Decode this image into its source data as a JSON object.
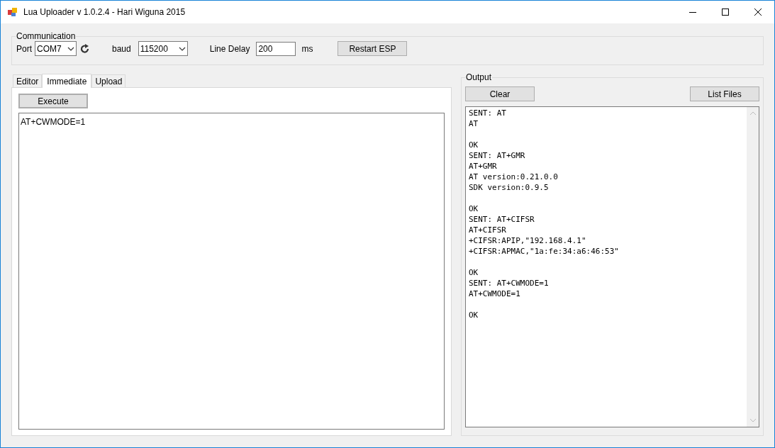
{
  "window": {
    "title": "Lua Uploader v 1.0.2.4 - Hari Wiguna 2015"
  },
  "communication": {
    "title": "Communication",
    "port_label": "Port",
    "port": "COM7",
    "baud_label": "baud",
    "baud": "115200",
    "line_delay_label": "Line Delay",
    "line_delay": "200",
    "line_delay_unit": "ms",
    "restart_button": "Restart ESP"
  },
  "tabs": [
    {
      "label": "Editor",
      "selected": false
    },
    {
      "label": "Immediate",
      "selected": true
    },
    {
      "label": "Upload",
      "selected": false
    }
  ],
  "immediate": {
    "execute_button": "Execute",
    "command": "AT+CWMODE=1"
  },
  "output": {
    "title": "Output",
    "clear_button": "Clear",
    "list_files_button": "List Files",
    "text": "SENT: AT\nAT\n\nOK\nSENT: AT+GMR\nAT+GMR\nAT version:0.21.0.0\nSDK version:0.9.5\n\nOK\nSENT: AT+CIFSR\nAT+CIFSR\n+CIFSR:APIP,\"192.168.4.1\"\n+CIFSR:APMAC,\"1a:fe:34:a6:46:53\"\n\nOK\nSENT: AT+CWMODE=1\nAT+CWMODE=1\n\nOK"
  }
}
